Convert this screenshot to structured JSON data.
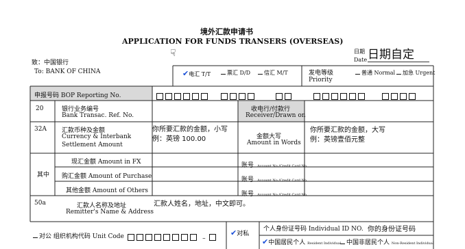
{
  "header": {
    "title_cn": "境外汇款申请书",
    "title_en": "APPLICATION FOR FUNDS TRANSERS (OVERSEAS)",
    "date_label_cn": "日期",
    "date_label_en": "Date",
    "date_value": "日期自定"
  },
  "to": {
    "cn": "致：中国银行",
    "en": "To: BANK OF CHINA"
  },
  "transfer_methods": [
    {
      "label": "电汇 T/T",
      "checked": true
    },
    {
      "label": "票汇 D/D",
      "checked": false
    },
    {
      "label": "信汇 M/T",
      "checked": false
    }
  ],
  "priority": {
    "cn": "发电等级",
    "en": "Priority",
    "normal": "普通 Normal",
    "urgent": "加急 Urgent"
  },
  "bop": {
    "label": "申报号码 BOP Reporting No."
  },
  "row20": {
    "code": "20",
    "label_cn": "银行业务编号",
    "label_en": "Bank Transac. Ref. No.",
    "receiver_cn": "收电行/付款行",
    "receiver_en": "Receiver/Drawn on"
  },
  "row32a": {
    "code": "32A",
    "label_cn": "汇款币种及金额",
    "label_en1": "Currency & Interbank",
    "label_en2": "Settlement Amount",
    "value_line1": "你所要汇款的金额，小写",
    "value_line2": "例：英镑 100.00",
    "words_cn": "金额大写",
    "words_en": "Amount in Words",
    "words_line1": "你所要汇款的金额，大写",
    "words_line2": "例：英镑壹佰元整"
  },
  "sub": {
    "group_label": "其中",
    "fx": "现汇金额 Amount in FX",
    "purchase": "购汇金额 Amount of Purchase",
    "others": "其他金额 Amount of Others",
    "account_cn": "账号",
    "account_en": "Account No./Credit Card No."
  },
  "row50a": {
    "code": "50a",
    "label_cn": "汇款人名称及地址",
    "label_en": "Remitter's Name & Address",
    "value": "汇款人姓名，地址，中文即可。"
  },
  "bottom": {
    "corporate": "对公 组织机构代码 Unit Code",
    "private": "对私",
    "id_label": "个人身份证号码 Individual ID NO.",
    "id_value": "你的身份证号码",
    "resident": "中国居民个人",
    "resident_en": "Resident Individual",
    "nonresident": "中国非居民个人",
    "nonresident_en": "Non-Resident Individual"
  },
  "colors": {
    "check": "#1a4fd8",
    "shade": "#d9d9d9",
    "line": "#222222"
  }
}
